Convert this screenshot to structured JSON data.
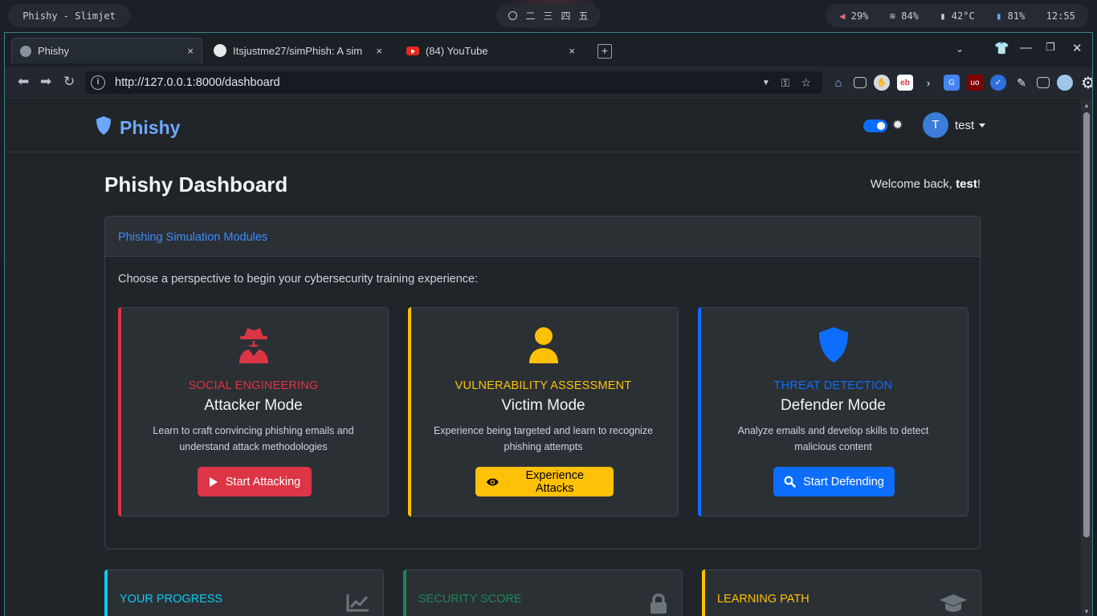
{
  "desktop": {
    "window_title": "Phishy - Slimjet",
    "workspaces": [
      "二",
      "三",
      "四",
      "五"
    ],
    "status": {
      "volume": "29%",
      "wifi": "84%",
      "temp": "42°C",
      "battery": "81%",
      "clock": "12:55"
    }
  },
  "browser": {
    "tabs": [
      {
        "label": "Phishy",
        "close": "×"
      },
      {
        "label": "Itsjustme27/simPhish: A sim",
        "close": "×"
      },
      {
        "label": "(84) YouTube",
        "close": "×"
      }
    ],
    "new_tab": "+",
    "url": "http://127.0.0.1:8000/dashboard"
  },
  "page": {
    "brand": "Phishy",
    "user": {
      "initial": "T",
      "name": "test"
    },
    "title": "Phishy Dashboard",
    "welcome_prefix": "Welcome back, ",
    "welcome_name": "test",
    "welcome_suffix": "!",
    "modules": {
      "heading": "Phishing Simulation Modules",
      "intro": "Choose a perspective to begin your cybersecurity training experience:",
      "cards": [
        {
          "category": "SOCIAL ENGINEERING",
          "name": "Attacker Mode",
          "description": "Learn to craft convincing phishing emails and understand attack methodologies",
          "button": "Start Attacking",
          "icon": "user-secret-icon",
          "color": "#dc3545"
        },
        {
          "category": "VULNERABILITY ASSESSMENT",
          "name": "Victim Mode",
          "description": "Experience being targeted and learn to recognize phishing attempts",
          "button": "Experience Attacks",
          "icon": "user-icon",
          "color": "#ffc107"
        },
        {
          "category": "THREAT DETECTION",
          "name": "Defender Mode",
          "description": "Analyze emails and develop skills to detect malicious content",
          "button": "Start Defending",
          "icon": "shield-icon",
          "color": "#0d6efd"
        }
      ]
    },
    "stats": [
      {
        "title": "YOUR PROGRESS",
        "icon": "chart-line-icon",
        "color": "#0dcaf0"
      },
      {
        "title": "SECURITY SCORE",
        "icon": "lock-icon",
        "color": "#198754"
      },
      {
        "title": "LEARNING PATH",
        "icon": "graduation-cap-icon",
        "color": "#ffc107"
      }
    ]
  }
}
